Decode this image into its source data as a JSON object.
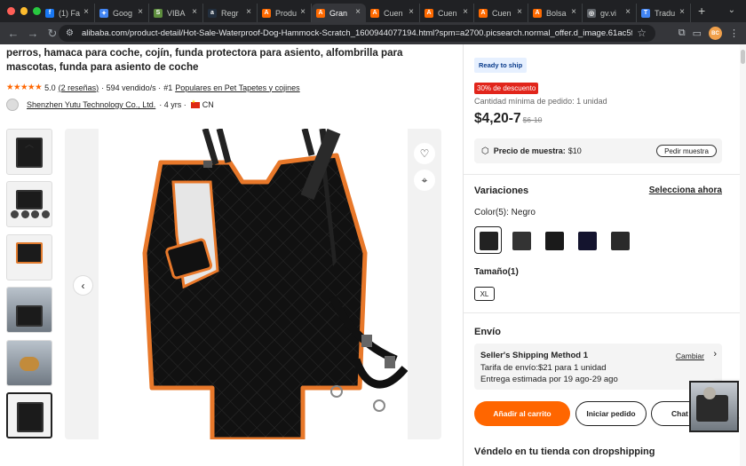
{
  "browser": {
    "tabs": [
      {
        "label": "(1) Fa",
        "icon": "facebook-icon",
        "color": "#1877f2",
        "glyph": "f"
      },
      {
        "label": "Goog",
        "icon": "gemini-icon",
        "color": "#4285f4",
        "glyph": "✦"
      },
      {
        "label": "VIBA",
        "icon": "shopify-icon",
        "color": "#5e8e3e",
        "glyph": "S"
      },
      {
        "label": "Regr",
        "icon": "amazon-icon",
        "color": "#232f3e",
        "glyph": "a"
      },
      {
        "label": "Produ",
        "icon": "alibaba-icon",
        "color": "#ff6a00",
        "glyph": "A"
      },
      {
        "label": "Gran",
        "icon": "alibaba-icon",
        "color": "#ff6a00",
        "glyph": "A",
        "active": true
      },
      {
        "label": "Cuen",
        "icon": "alibaba-icon",
        "color": "#ff6a00",
        "glyph": "A"
      },
      {
        "label": "Cuen",
        "icon": "alibaba-icon",
        "color": "#ff6a00",
        "glyph": "A"
      },
      {
        "label": "Cuen",
        "icon": "alibaba-icon",
        "color": "#ff6a00",
        "glyph": "A"
      },
      {
        "label": "Bolsa",
        "icon": "alibaba-icon",
        "color": "#ff6a00",
        "glyph": "A"
      },
      {
        "label": "gv.vi",
        "icon": "globe-icon",
        "color": "#5f6368",
        "glyph": "◎"
      },
      {
        "label": "Tradu",
        "icon": "translate-icon",
        "color": "#4285f4",
        "glyph": "T"
      }
    ],
    "new_tab": "+",
    "url": "alibaba.com/product-detail/Hot-Sale-Waterproof-Dog-Hammock-Scratch_1600944077194.html?spm=a2700.picsearch.normal_offer.d_image.61ac5f93ldZY2U",
    "profile_initials": "BC"
  },
  "product": {
    "title": "perros, hamaca para coche, cojín, funda protectora para asiento, alfombrilla para mascotas, funda para asiento de coche",
    "stars": "★★★★★",
    "rating": "5.0",
    "reviews": "(2 reseñas)",
    "sold": "· 594 vendido/s ·",
    "rank": "#1",
    "rank_category": "Populares en Pet Tapetes y cojines",
    "supplier": "Shenzhen Yutu Technology Co., Ltd.",
    "supplier_years": "· 4 yrs ·",
    "country": "CN"
  },
  "right_panel": {
    "ready_to_ship": "Ready to ship",
    "discount": "30% de descuento",
    "moq": "Cantidad mínima de pedido: 1 unidad",
    "price": "$4,20-7",
    "old_price": "$6-10",
    "sample_label": "Precio de muestra:",
    "sample_value": "$10",
    "sample_button": "Pedir muestra",
    "variations_title": "Variaciones",
    "select_now": "Selecciona ahora",
    "color_label": "Color(5): Negro",
    "size_label": "Tamaño(1)",
    "size_value": "XL",
    "shipping_title": "Envío",
    "shipping_method": "Seller's Shipping Method 1",
    "shipping_change": "Cambiar",
    "shipping_fee": "Tarifa de envío:$21 para 1 unidad",
    "shipping_delivery": "Entrega estimada por 19 ago-29 ago",
    "add_to_cart": "Añadir al carrito",
    "start_order": "Iniciar pedido",
    "chat": "Chat",
    "dropship": "Véndelo en tu tienda con dropshipping"
  },
  "floating": {
    "message_badge": "2"
  },
  "colors": {
    "accent": "#ff6600",
    "discount": "#e1251b",
    "tab_bg": "#202124",
    "toolbar_bg": "#35363a"
  }
}
